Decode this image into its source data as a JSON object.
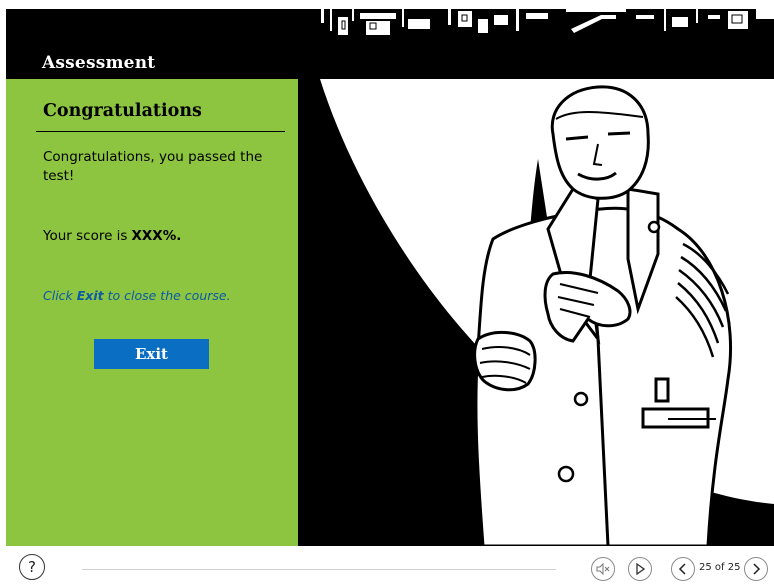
{
  "header": {
    "title": "Assessment"
  },
  "panel": {
    "title": "Congratulations",
    "message": "Congratulations, you passed the test!",
    "score_label": "Your score is",
    "score_value": "XXX%.",
    "hint_prefix": "Click ",
    "hint_keyword": "Exit",
    "hint_suffix": " to close the course.",
    "exit_label": "Exit"
  },
  "player": {
    "page_count": "25 of 25"
  },
  "colors": {
    "panel_bg": "#8dc540",
    "header_bg": "#000000",
    "exit_button": "#0a6fc2",
    "hint_text": "#0b5aa6"
  },
  "icons": {
    "help": "question-icon",
    "mute": "speaker-mute-icon",
    "play": "play-icon",
    "prev": "chevron-left-icon",
    "next": "chevron-right-icon"
  }
}
